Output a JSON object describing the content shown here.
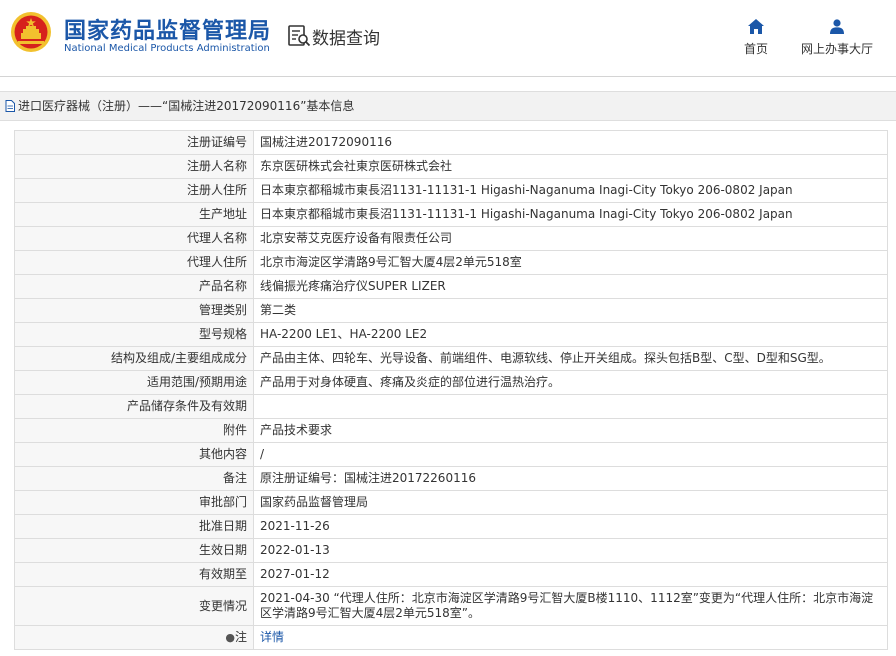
{
  "header": {
    "org_name_cn": "国家药品监督管理局",
    "org_name_en": "National Medical Products Administration",
    "section_title": "数据查询",
    "nav": {
      "home_label": "首页",
      "service_hall_label": "网上办事大厅"
    },
    "colors": {
      "brand_blue": "#1b57a8",
      "emblem_red": "#d6221c",
      "emblem_gold": "#f2c12e"
    }
  },
  "breadcrumb": {
    "text": "进口医疗器械（注册）——“国械注进20172090116”基本信息"
  },
  "record": {
    "rows": [
      {
        "label": "注册证编号",
        "value": "国械注进20172090116"
      },
      {
        "label": "注册人名称",
        "value": "东京医研株式会社東京医研株式会社"
      },
      {
        "label": "注册人住所",
        "value": "日本東京都稲城市東長沼1131-11131-1 Higashi-Naganuma Inagi-City Tokyo 206-0802 Japan"
      },
      {
        "label": "生产地址",
        "value": "日本東京都稲城市東長沼1131-11131-1 Higashi-Naganuma Inagi-City Tokyo 206-0802 Japan"
      },
      {
        "label": "代理人名称",
        "value": "北京安蒂艾克医疗设备有限责任公司"
      },
      {
        "label": "代理人住所",
        "value": "北京市海淀区学清路9号汇智大厦4层2单元518室"
      },
      {
        "label": "产品名称",
        "value": "线偏振光疼痛治疗仪SUPER LIZER"
      },
      {
        "label": "管理类别",
        "value": "第二类"
      },
      {
        "label": "型号规格",
        "value": "HA-2200 LE1、HA-2200 LE2"
      },
      {
        "label": "结构及组成/主要组成成分",
        "value": "产品由主体、四轮车、光导设备、前端组件、电源软线、停止开关组成。探头包括B型、C型、D型和SG型。"
      },
      {
        "label": "适用范围/预期用途",
        "value": "产品用于对身体硬直、疼痛及炎症的部位进行温热治疗。"
      },
      {
        "label": "产品储存条件及有效期",
        "value": ""
      },
      {
        "label": "附件",
        "value": "产品技术要求"
      },
      {
        "label": "其他内容",
        "value": "/"
      },
      {
        "label": "备注",
        "value": "原注册证编号：国械注进20172260116"
      },
      {
        "label": "审批部门",
        "value": "国家药品监督管理局"
      },
      {
        "label": "批准日期",
        "value": "2021-11-26"
      },
      {
        "label": "生效日期",
        "value": "2022-01-13"
      },
      {
        "label": "有效期至",
        "value": "2027-01-12"
      },
      {
        "label": "变更情况",
        "value": "2021-04-30 “代理人住所：北京市海淀区学清路9号汇智大厦B楼1110、1112室”变更为“代理人住所：北京市海淀区学清路9号汇智大厦4层2单元518室”。"
      }
    ],
    "note": {
      "label": "注",
      "icon": "pin-icon",
      "link_text": "详情"
    }
  }
}
